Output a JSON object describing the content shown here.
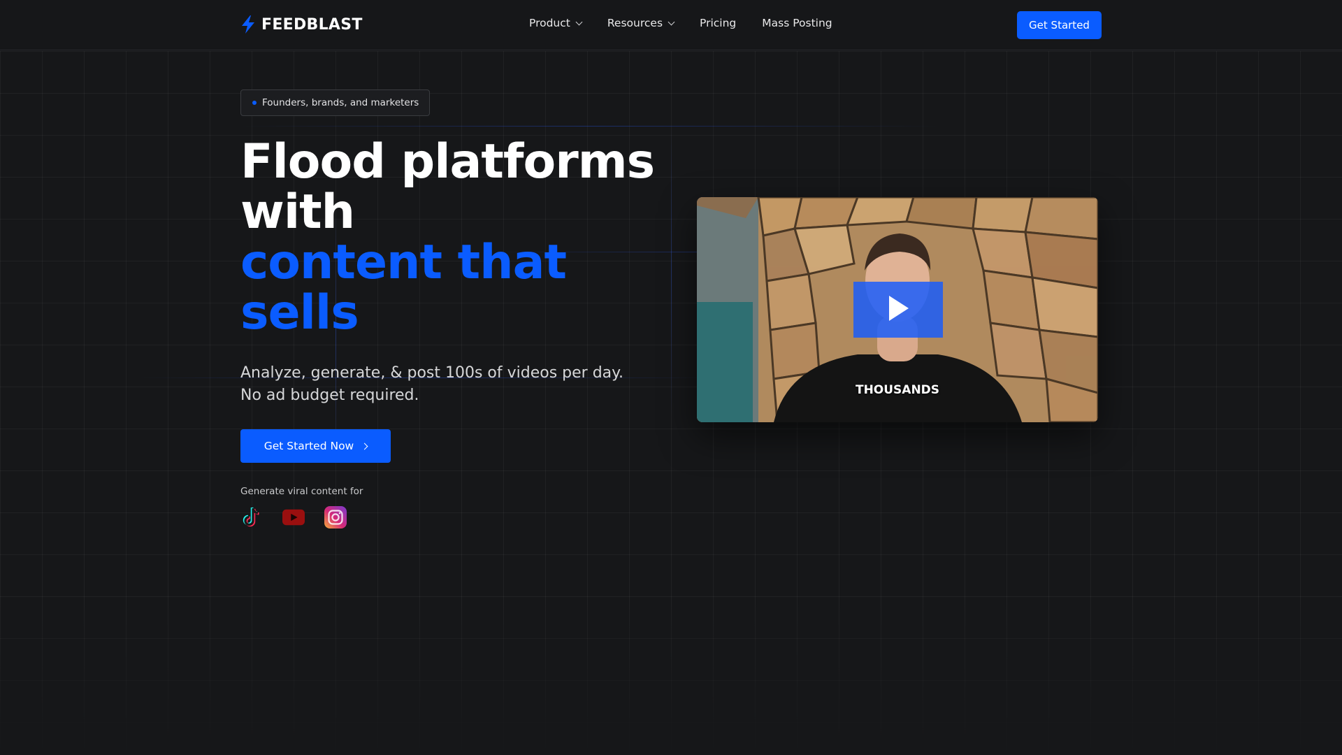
{
  "brand": {
    "name": "FEEDBLAST",
    "logo_icon": "lightning-bolt-icon",
    "accent_color": "#0a5cff",
    "background_color": "#161719"
  },
  "nav": {
    "items": [
      {
        "label": "Product",
        "has_dropdown": true
      },
      {
        "label": "Resources",
        "has_dropdown": true
      },
      {
        "label": "Pricing",
        "has_dropdown": false
      },
      {
        "label": "Mass Posting",
        "has_dropdown": false
      }
    ],
    "cta_label": "Get Started"
  },
  "hero": {
    "badge": "Founders, brands, and marketers",
    "headline_line1": "Flood platforms",
    "headline_line2": "with",
    "headline_highlight_line1": "content that",
    "headline_highlight_line2": "sells",
    "subtext_line1": "Analyze, generate, & post 100s of videos per day.",
    "subtext_line2": "No ad budget required.",
    "cta_label": "Get Started Now",
    "platforms_label": "Generate viral content for",
    "platforms": [
      "tiktok-icon",
      "youtube-icon",
      "instagram-icon"
    ]
  },
  "video": {
    "caption": "THOUSANDS",
    "play_icon": "play-icon"
  }
}
